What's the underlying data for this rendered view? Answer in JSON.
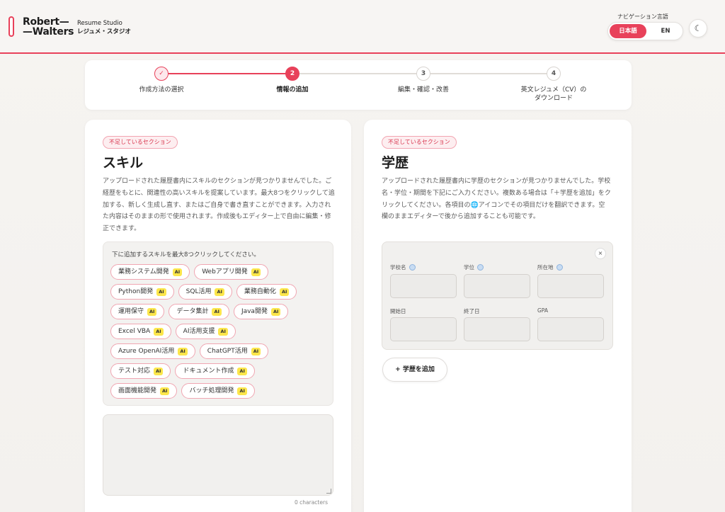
{
  "header": {
    "brand_line1": "Robert—",
    "brand_line2": "—Walters",
    "studio_en": "Resume Studio",
    "studio_jp": "レジュメ・スタジオ",
    "nav_lang_label": "ナビゲーション言語",
    "lang_ja": "日本語",
    "lang_en": "EN",
    "theme_icon": "☾"
  },
  "stepper": {
    "steps": [
      {
        "num": "✓",
        "label": "作成方法の選択",
        "state": "done"
      },
      {
        "num": "2",
        "label": "情報の追加",
        "state": "active"
      },
      {
        "num": "3",
        "label": "編集・確認・改善",
        "state": "todo"
      },
      {
        "num": "4",
        "label": "英文レジュメ（CV）の\nダウンロード",
        "state": "todo"
      }
    ]
  },
  "skills": {
    "badge": "不足しているセクション",
    "title": "スキル",
    "description": "アップロードされた履歴書内にスキルのセクションが見つかりませんでした。ご経歴をもとに、関連性の高いスキルを提案しています。最大8つをクリックして追加する、新しく生成し直す、またはご自身で書き直すことができます。入力された内容はそのままの形で使用されます。作成後もエディター上で自由に編集・修正できます。",
    "hint": "下に追加するスキルを最大8つクリックしてください。",
    "ai_tag": "AI",
    "chip_rows": [
      [
        "業務システム開発",
        "Webアプリ開発"
      ],
      [
        "Python開発",
        "SQL活用",
        "業務自動化"
      ],
      [
        "運用保守",
        "データ集計",
        "Java開発"
      ],
      [
        "Excel VBA",
        "AI活用支援"
      ],
      [
        "Azure OpenAI活用",
        "ChatGPT活用"
      ],
      [
        "テスト対応",
        "ドキュメント作成"
      ],
      [
        "画面機能開発",
        "バッチ処理開発"
      ]
    ],
    "textarea_value": "",
    "char_count": "0 characters"
  },
  "education": {
    "badge": "不足しているセクション",
    "title": "学歴",
    "description": "アップロードされた履歴書内に学歴のセクションが見つかりませんでした。学校名・学位・期間を下記にご入力ください。複数ある場合は「＋学歴を追加」をクリックしてください。各項目の🌐アイコンでその項目だけを翻訳できます。空欄のままエディターで後から追加することも可能です。",
    "close_icon": "×",
    "fields": {
      "school": "学校名",
      "degree": "学位",
      "location": "所在地",
      "start": "開始日",
      "end": "終了日",
      "gpa": "GPA"
    },
    "add_button": "+ 学歴を追加"
  }
}
